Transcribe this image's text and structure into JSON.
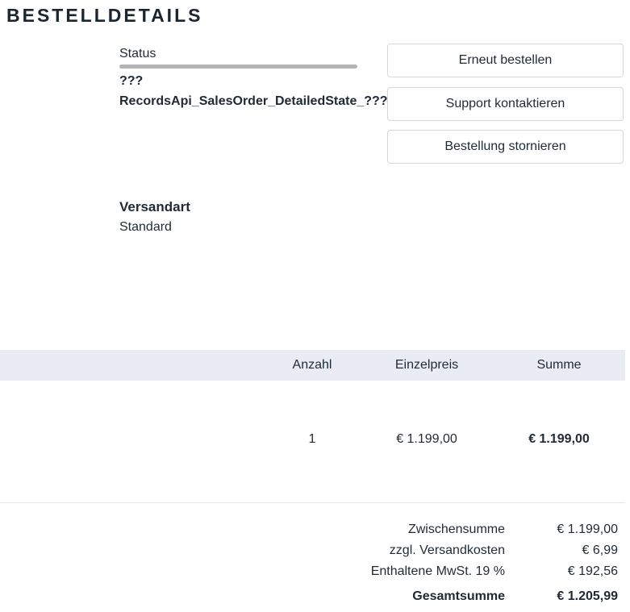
{
  "page": {
    "title": "BESTELLDETAILS"
  },
  "status": {
    "label": "Status",
    "progress": 0,
    "unknown_text": "???",
    "state_text": "RecordsApi_SalesOrder_DetailedState_???"
  },
  "actions": {
    "reorder": "Erneut bestellen",
    "support": "Support kontaktieren",
    "cancel": "Bestellung stornieren"
  },
  "shipping": {
    "label": "Versandart",
    "value": "Standard"
  },
  "table": {
    "headers": {
      "quantity": "Anzahl",
      "unit_price": "Einzelpreis",
      "total": "Summe"
    },
    "rows": [
      {
        "quantity": "1",
        "unit_price": "€ 1.199,00",
        "total": "€ 1.199,00"
      }
    ]
  },
  "summary": {
    "subtotal_label": "Zwischensumme",
    "subtotal_value": "€ 1.199,00",
    "shipping_label": "zzgl. Versandkosten",
    "shipping_value": "€ 6,99",
    "vat_label": "Enthaltene MwSt. 19 %",
    "vat_value": "€ 192,56",
    "grand_total_label": "Gesamtsumme",
    "grand_total_value": "€ 1.205,99"
  }
}
